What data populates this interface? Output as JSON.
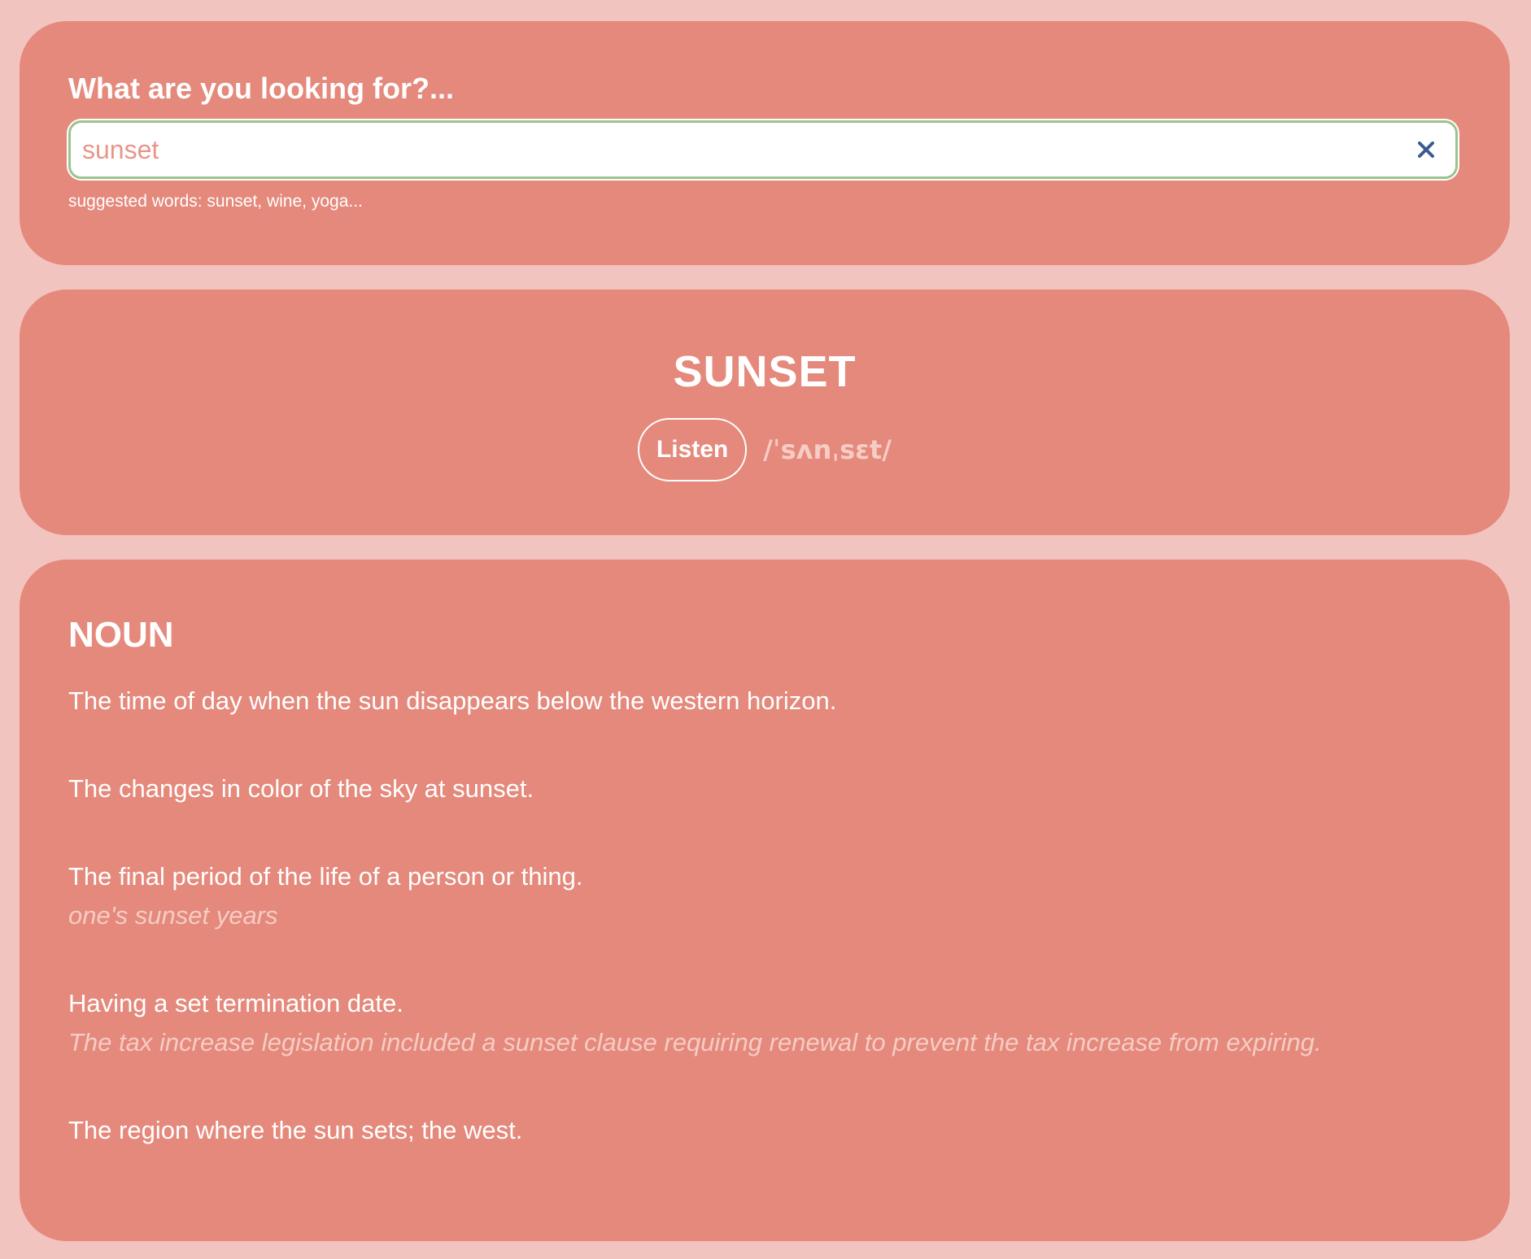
{
  "search": {
    "label": "What are you looking for?...",
    "value": "sunset",
    "placeholder": "",
    "suggestions_text": "suggested words: sunset, wine, yoga...",
    "clear_icon": "close-icon"
  },
  "word": {
    "title": "SUNSET",
    "listen_label": "Listen",
    "phonetic": "/ˈsʌnˌsɛt/"
  },
  "definitions": {
    "part_of_speech": "NOUN",
    "items": [
      {
        "text": "The time of day when the sun disappears below the western horizon.",
        "example": ""
      },
      {
        "text": "The changes in color of the sky at sunset.",
        "example": ""
      },
      {
        "text": "The final period of the life of a person or thing.",
        "example": "one's sunset years"
      },
      {
        "text": "Having a set termination date.",
        "example": "The tax increase legislation included a sunset clause requiring renewal to prevent the tax increase from expiring."
      },
      {
        "text": "The region where the sun sets; the west.",
        "example": ""
      }
    ]
  },
  "colors": {
    "background": "#f2c4bf",
    "card": "#e4897b",
    "input_border": "#9cc38d",
    "clear_icon": "#3b5a8f",
    "muted_text": "#f6ccc5"
  }
}
